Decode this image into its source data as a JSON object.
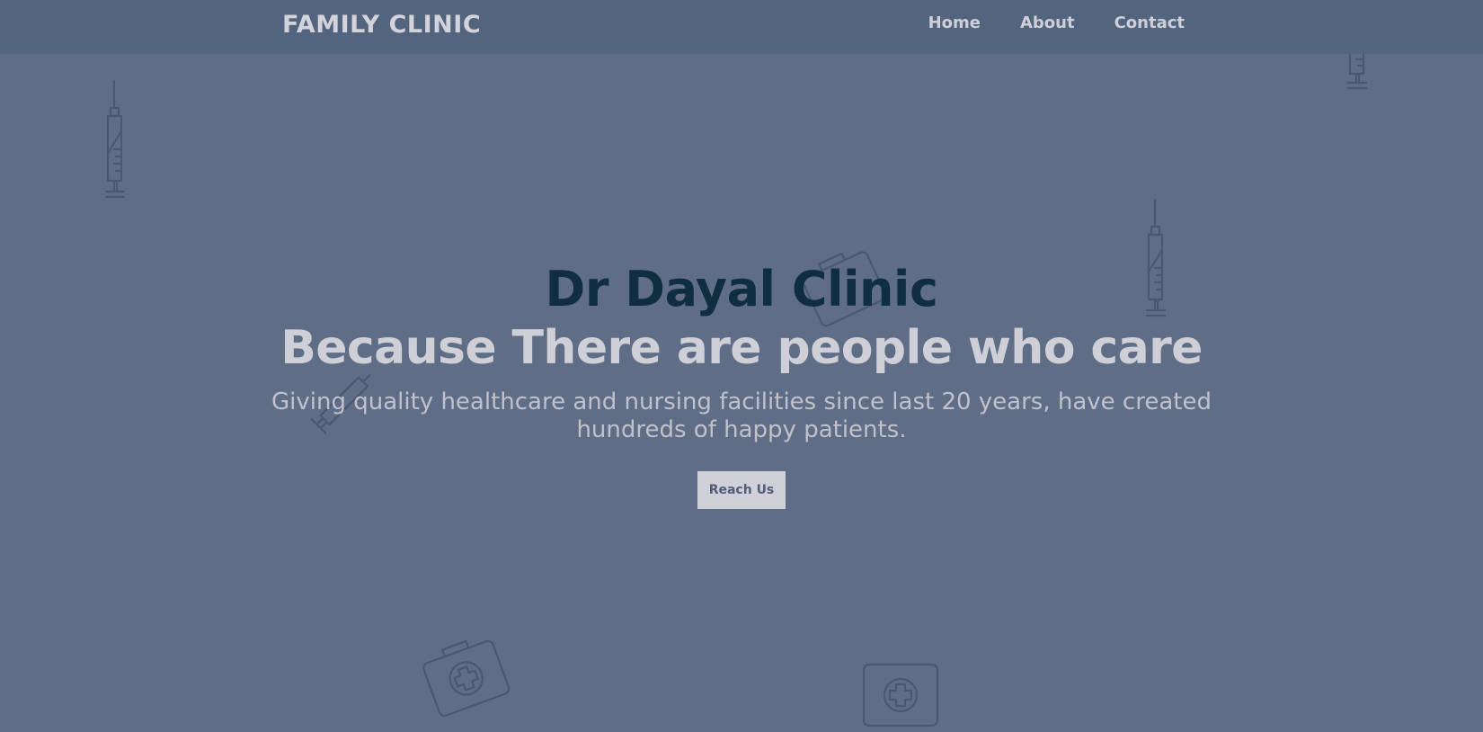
{
  "navbar": {
    "brand": "FAMILY CLINIC",
    "links": [
      "Home",
      "About",
      "Contact"
    ]
  },
  "hero": {
    "title": "Dr Dayal Clinic",
    "tagline": "Because There are people who care",
    "description": "Giving quality healthcare and nursing facilities since last 20 years, have created hundreds of happy patients.",
    "button_label": "Reach Us"
  },
  "background_icons": [
    "syringe-icon",
    "syringe-icon",
    "syringe-icon",
    "syringe-icon",
    "first-aid-kit-icon",
    "first-aid-kit-icon",
    "first-aid-kit-icon"
  ],
  "colors": {
    "background": "#5f6e86",
    "navbar": "#53647e",
    "title": "#0f2f41",
    "tagline": "#cfcfd7",
    "button_bg": "#cfd0d8",
    "button_text": "#4f5e76"
  }
}
